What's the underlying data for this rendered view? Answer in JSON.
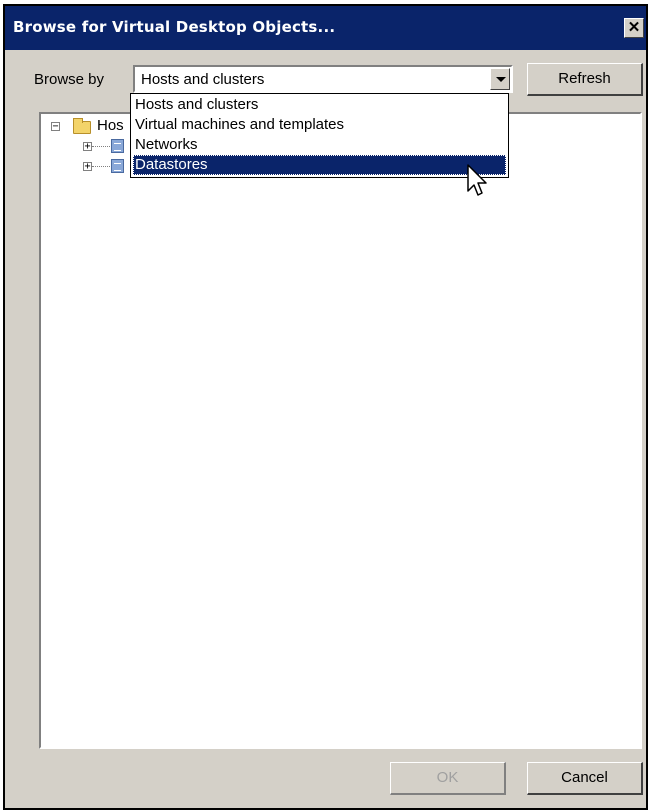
{
  "window": {
    "title": "Browse for Virtual Desktop Objects...",
    "close_icon": "close-icon",
    "close_glyph": "✕"
  },
  "toolbar": {
    "browse_label": "Browse by",
    "combo_value": "Hosts and clusters",
    "refresh_label": "Refresh"
  },
  "dropdown": {
    "items": [
      {
        "label": "Hosts and clusters",
        "selected": false
      },
      {
        "label": "Virtual machines and templates",
        "selected": false
      },
      {
        "label": "Networks",
        "selected": false
      },
      {
        "label": "Datastores",
        "selected": true
      }
    ]
  },
  "tree": {
    "root_label": "Hos",
    "children": [
      {
        "label": "",
        "icon": "datacenter-icon"
      },
      {
        "label": "",
        "icon": "datacenter-icon"
      }
    ]
  },
  "footer": {
    "ok_label": "OK",
    "cancel_label": "Cancel"
  },
  "colors": {
    "title_bar": "#0a246a",
    "dialog_face": "#d4d0c8",
    "selection": "#0a246a"
  }
}
